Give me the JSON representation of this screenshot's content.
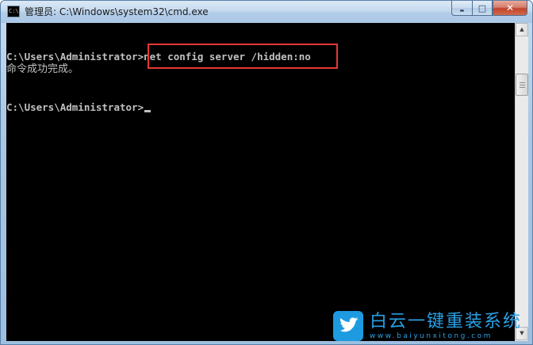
{
  "window": {
    "title": "管理员: C:\\Windows\\system32\\cmd.exe",
    "icon": "cmd-icon",
    "icon_text": "C:\\"
  },
  "controls": {
    "minimize_icon": "minimize-icon",
    "minimize": "▬",
    "maximize_icon": "maximize-icon",
    "maximize": "□",
    "close_icon": "close-icon",
    "close": "✕"
  },
  "console": {
    "lines": [
      "C:\\Users\\Administrator>net config server /hidden:no",
      "命令成功完成。",
      "",
      "C:\\Users\\Administrator>"
    ],
    "highlight_color": "#e53935",
    "text_color": "#c0c0c0",
    "background": "#000000"
  },
  "scrollbar": {
    "up_arrow": "▲",
    "down_arrow": "▼"
  },
  "watermark": {
    "title": "白云一键重装系统",
    "url": "www.baiyunxitong.com",
    "color": "#2aa0e6"
  }
}
